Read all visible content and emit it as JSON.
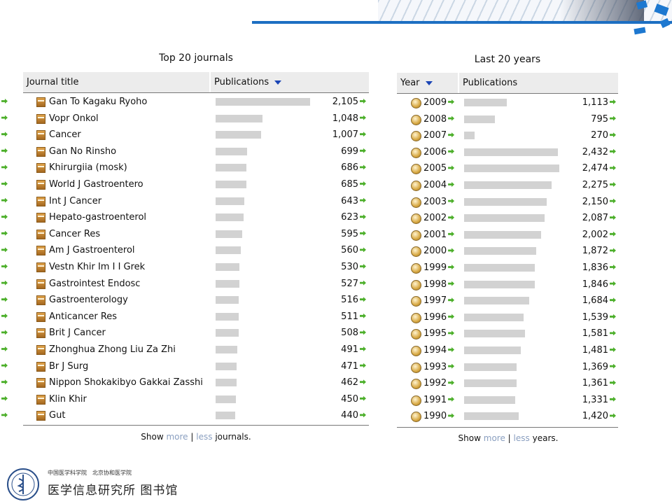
{
  "journals": {
    "title": "Top 20 journals",
    "columns": {
      "journal": "Journal title",
      "publications": "Publications"
    },
    "max": 2105,
    "rows": [
      {
        "name": "Gan To Kagaku Ryoho",
        "value": "2,105",
        "count": 2105
      },
      {
        "name": "Vopr Onkol",
        "value": "1,048",
        "count": 1048
      },
      {
        "name": "Cancer",
        "value": "1,007",
        "count": 1007
      },
      {
        "name": "Gan No Rinsho",
        "value": "699",
        "count": 699
      },
      {
        "name": "Khirurgiia (mosk)",
        "value": "686",
        "count": 686
      },
      {
        "name": "World J Gastroentero",
        "value": "685",
        "count": 685
      },
      {
        "name": "Int J Cancer",
        "value": "643",
        "count": 643
      },
      {
        "name": "Hepato-gastroenterol",
        "value": "623",
        "count": 623
      },
      {
        "name": "Cancer Res",
        "value": "595",
        "count": 595
      },
      {
        "name": "Am J Gastroenterol",
        "value": "560",
        "count": 560
      },
      {
        "name": "Vestn Khir Im I I Grek",
        "value": "530",
        "count": 530
      },
      {
        "name": "Gastrointest Endosc",
        "value": "527",
        "count": 527
      },
      {
        "name": "Gastroenterology",
        "value": "516",
        "count": 516
      },
      {
        "name": "Anticancer Res",
        "value": "511",
        "count": 511
      },
      {
        "name": "Brit J Cancer",
        "value": "508",
        "count": 508
      },
      {
        "name": "Zhonghua Zhong Liu Za Zhi",
        "value": "491",
        "count": 491
      },
      {
        "name": "Br J Surg",
        "value": "471",
        "count": 471
      },
      {
        "name": "Nippon Shokakibyo Gakkai Zasshi",
        "value": "462",
        "count": 462
      },
      {
        "name": "Klin Khir",
        "value": "450",
        "count": 450
      },
      {
        "name": "Gut",
        "value": "440",
        "count": 440
      }
    ],
    "footer": {
      "show": "Show",
      "more": "more",
      "sep": "|",
      "less": "less",
      "suffix": "journals."
    }
  },
  "years": {
    "title": "Last 20 years",
    "columns": {
      "year": "Year",
      "publications": "Publications"
    },
    "max": 2474,
    "rows": [
      {
        "year": "2009",
        "value": "1,113",
        "count": 1113
      },
      {
        "year": "2008",
        "value": "795",
        "count": 795
      },
      {
        "year": "2007",
        "value": "270",
        "count": 270
      },
      {
        "year": "2006",
        "value": "2,432",
        "count": 2432
      },
      {
        "year": "2005",
        "value": "2,474",
        "count": 2474
      },
      {
        "year": "2004",
        "value": "2,275",
        "count": 2275
      },
      {
        "year": "2003",
        "value": "2,150",
        "count": 2150
      },
      {
        "year": "2002",
        "value": "2,087",
        "count": 2087
      },
      {
        "year": "2001",
        "value": "2,002",
        "count": 2002
      },
      {
        "year": "2000",
        "value": "1,872",
        "count": 1872
      },
      {
        "year": "1999",
        "value": "1,836",
        "count": 1836
      },
      {
        "year": "1998",
        "value": "1,846",
        "count": 1846
      },
      {
        "year": "1997",
        "value": "1,684",
        "count": 1684
      },
      {
        "year": "1996",
        "value": "1,539",
        "count": 1539
      },
      {
        "year": "1995",
        "value": "1,581",
        "count": 1581
      },
      {
        "year": "1994",
        "value": "1,481",
        "count": 1481
      },
      {
        "year": "1993",
        "value": "1,369",
        "count": 1369
      },
      {
        "year": "1992",
        "value": "1,361",
        "count": 1361
      },
      {
        "year": "1991",
        "value": "1,331",
        "count": 1331
      },
      {
        "year": "1990",
        "value": "1,420",
        "count": 1420
      }
    ],
    "footer": {
      "show": "Show",
      "more": "more",
      "sep": "|",
      "less": "less",
      "suffix": "years."
    }
  },
  "branding": {
    "org_line1": "中国医学科学院　北京协和医学院",
    "org_line2": "医学信息研究所 图书馆",
    "logo_text": "IMICAMS"
  },
  "colors": {
    "accent": "#1d78d0",
    "bar": "#d2d2d2",
    "link_arrow": "#4caf2a",
    "sort_arrow": "#1a44b5"
  }
}
